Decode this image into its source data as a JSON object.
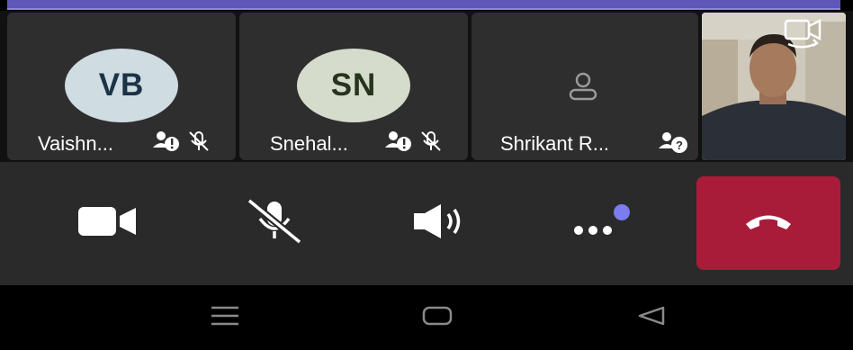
{
  "participants": [
    {
      "initials": "VB",
      "name": "Vaishn...",
      "avatar_bg": "#cfdce2",
      "avatar_fg": "#1c3347",
      "muted": true
    },
    {
      "initials": "SN",
      "name": "Snehal...",
      "avatar_bg": "#d6dccc",
      "avatar_fg": "#27341c",
      "muted": true
    },
    {
      "initials": "",
      "name": "Shrikant R...",
      "avatar_bg": "#2e2e2e",
      "avatar_fg": "#9a9a9a",
      "muted": false
    }
  ],
  "icons": {
    "top_strip": "presenter-banner",
    "camera_switch": "camera-switch-icon",
    "camera": "video-camera-icon",
    "mic": "mic-muted-icon",
    "speaker": "speaker-icon",
    "more": "more-options-icon",
    "hangup": "hang-up-icon",
    "nav_menu": "menu-icon",
    "nav_home": "home-icon",
    "nav_back": "back-icon"
  },
  "colors": {
    "accent": "#7a7cf0",
    "end_call": "#a81c3a",
    "tile_bg": "#2e2e2e",
    "controls_bg": "#2a2a2a"
  }
}
